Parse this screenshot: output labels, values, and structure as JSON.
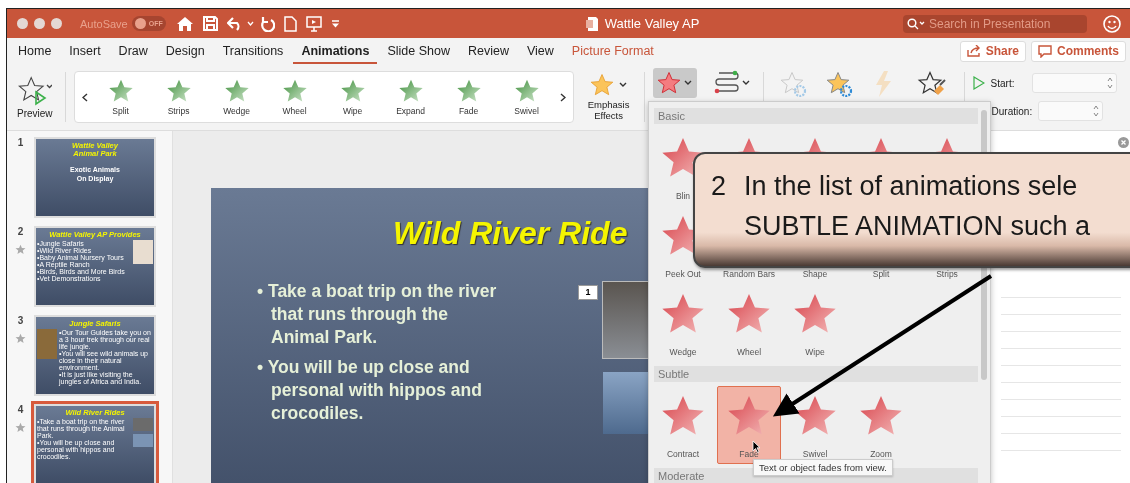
{
  "window": {
    "title": "Wattle Valley AP",
    "autosave_label": "AutoSave",
    "autosave_on": false,
    "autosave_state": "OFF",
    "search_placeholder": "Search in Presentation"
  },
  "tabs": [
    {
      "label": "Home",
      "selected": false,
      "kind": "standard"
    },
    {
      "label": "Insert",
      "selected": false,
      "kind": "standard"
    },
    {
      "label": "Draw",
      "selected": false,
      "kind": "standard"
    },
    {
      "label": "Design",
      "selected": false,
      "kind": "standard"
    },
    {
      "label": "Transitions",
      "selected": false,
      "kind": "standard"
    },
    {
      "label": "Animations",
      "selected": true,
      "kind": "standard"
    },
    {
      "label": "Slide Show",
      "selected": false,
      "kind": "standard"
    },
    {
      "label": "Review",
      "selected": false,
      "kind": "standard"
    },
    {
      "label": "View",
      "selected": false,
      "kind": "standard"
    },
    {
      "label": "Picture Format",
      "selected": false,
      "kind": "contextual"
    }
  ],
  "share": "Share",
  "comments": "Comments",
  "ribbon": {
    "preview": "Preview",
    "effects": [
      {
        "label": "Split"
      },
      {
        "label": "Strips"
      },
      {
        "label": "Wedge"
      },
      {
        "label": "Wheel"
      },
      {
        "label": "Wipe"
      },
      {
        "label": "Expand"
      },
      {
        "label": "Fade"
      },
      {
        "label": "Swivel"
      }
    ],
    "emphasis": "Emphasis Effects",
    "effects_menu_open": true,
    "tools": [
      {
        "kind": "effect-options",
        "disabled": true
      },
      {
        "kind": "add-animation",
        "disabled": false
      },
      {
        "kind": "trigger",
        "disabled": true
      },
      {
        "kind": "animation-painter",
        "disabled": false
      }
    ],
    "start_label": "Start:",
    "duration_label": "Duration:"
  },
  "slides": [
    {
      "number": "1",
      "animated": false,
      "selected": false,
      "kind": "title",
      "title": "Wattle Valley\nAnimal Park",
      "subtitle": "Exotic Animals\nOn Display"
    },
    {
      "number": "2",
      "animated": true,
      "selected": false,
      "kind": "clipart",
      "title": "Wattle Valley AP Provides",
      "bullets": [
        "•Jungle Safaris",
        "•Wild River Rides",
        "•Baby Animal Nursery Tours",
        "•A Reptile Ranch",
        "•Birds, Birds and More Birds",
        "•Vet Demonstrations"
      ]
    },
    {
      "number": "3",
      "animated": true,
      "selected": false,
      "kind": "photo",
      "title": "Jungle Safaris",
      "bullets": [
        "•Our Tour Guides take you on a 3 hour trek through our real life jungle.",
        "•You will see wild animals up close in their natural environment.",
        "•It is just like visiting the jungles of Africa and India."
      ]
    },
    {
      "number": "4",
      "animated": true,
      "selected": true,
      "kind": "photos",
      "title": "Wild River Rides",
      "bullets": [
        "•Take a boat trip on the river that runs through the Animal Park.",
        "•You will be up close and personal with hippos and crocodiles."
      ]
    }
  ],
  "slide": {
    "title": "Wild River Ride",
    "bullets": [
      "• Take a boat trip on the river that runs through the Animal Park.",
      "• You will be up close and personal with hippos and crocodiles."
    ],
    "animation_tag": "1"
  },
  "gallery": {
    "sections": [
      {
        "title": "Basic",
        "items": [
          {
            "label": "Blin",
            "selected": false
          },
          {
            "selected": false
          },
          {
            "selected": false
          },
          {
            "selected": false
          },
          {
            "selected": false
          },
          {
            "label": "Peek Out",
            "selected": false
          },
          {
            "label": "Random Bars",
            "selected": false
          },
          {
            "label": "Shape",
            "selected": false
          },
          {
            "label": "Split",
            "selected": false
          },
          {
            "label": "Strips",
            "selected": false
          },
          {
            "label": "Wedge",
            "selected": false
          },
          {
            "label": "Wheel",
            "selected": false
          },
          {
            "label": "Wipe",
            "selected": false
          }
        ]
      },
      {
        "title": "Subtle",
        "items": [
          {
            "label": "Contract",
            "selected": false
          },
          {
            "label": "Fade",
            "selected": true
          },
          {
            "label": "Swivel",
            "selected": false
          },
          {
            "label": "Zoom",
            "selected": false
          }
        ]
      },
      {
        "title": "Moderate"
      }
    ]
  },
  "tooltip": "Text or object fades from view.",
  "callout": {
    "number": "2",
    "text": "In the list of animations sele\nSUBTLE ANIMATION such a"
  }
}
